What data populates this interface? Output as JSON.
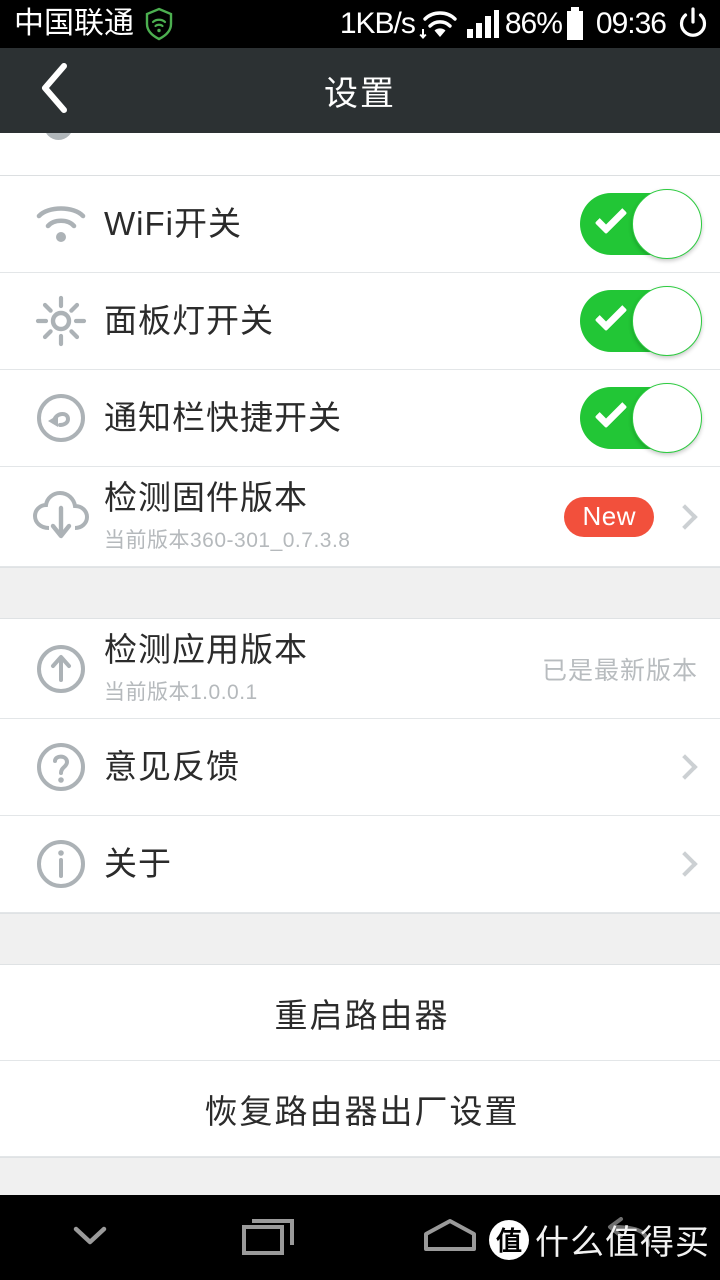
{
  "status_bar": {
    "carrier": "中国联通",
    "shield_icon": "wifi-shield-icon",
    "net_speed": "1KB/s",
    "wifi_icon": "wifi-icon",
    "signal_icon": "signal-bars-icon",
    "battery_percent": "86%",
    "battery_icon": "battery-icon",
    "time": "09:36",
    "power_icon": "power-icon"
  },
  "header": {
    "back_icon": "back-chevron-icon",
    "title": "设置"
  },
  "sections": [
    {
      "rows": [
        {
          "icon": "wifi-icon",
          "title": "WiFi开关",
          "control": "toggle",
          "on": true
        },
        {
          "icon": "brightness-icon",
          "title": "面板灯开关",
          "control": "toggle",
          "on": true
        },
        {
          "icon": "notification-shortcut-icon",
          "title": "通知栏快捷开关",
          "control": "toggle",
          "on": true
        },
        {
          "icon": "cloud-download-icon",
          "title": "检测固件版本",
          "subtitle": "当前版本360-301_0.7.3.8",
          "badge": "New",
          "control": "chevron"
        }
      ]
    },
    {
      "rows": [
        {
          "icon": "arrow-up-circle-icon",
          "title": "检测应用版本",
          "subtitle": "当前版本1.0.0.1",
          "value": "已是最新版本",
          "control": "none"
        },
        {
          "icon": "question-circle-icon",
          "title": "意见反馈",
          "control": "chevron"
        },
        {
          "icon": "info-circle-icon",
          "title": "关于",
          "control": "chevron"
        }
      ]
    },
    {
      "rows": [
        {
          "title": "重启路由器",
          "control": "action"
        },
        {
          "title": "恢复路由器出厂设置",
          "control": "action"
        }
      ]
    }
  ],
  "nav_bar": {
    "items": [
      {
        "icon": "chevron-down-icon"
      },
      {
        "icon": "recents-icon"
      },
      {
        "icon": "home-icon"
      },
      {
        "icon": "back-arrow-icon"
      }
    ],
    "watermark_logo": "值",
    "watermark_text": "什么值得买"
  },
  "colors": {
    "toggle_on": "#22c636",
    "badge": "#f2503c",
    "header_bg": "#2c3133",
    "section_gap": "#f0f0f0"
  }
}
